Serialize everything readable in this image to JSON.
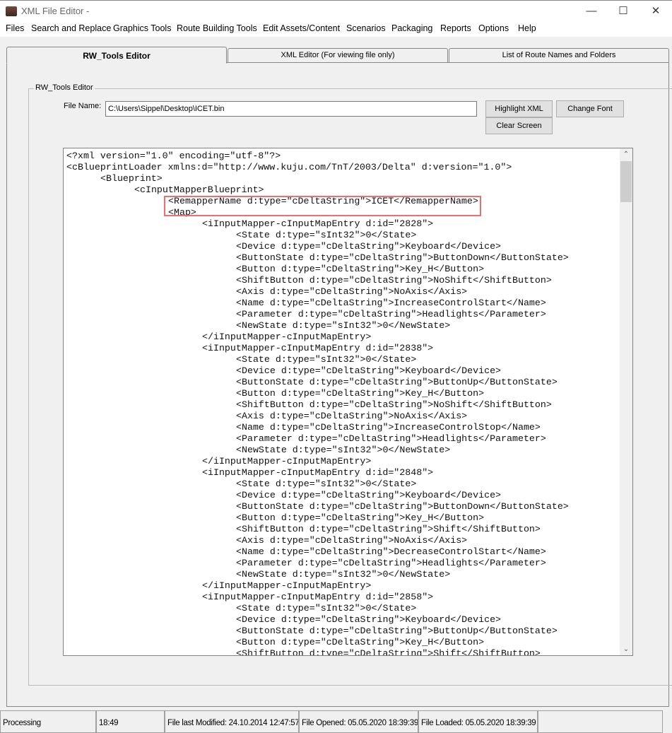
{
  "window": {
    "title": "XML File Editor -",
    "minimize": "—",
    "maximize": "☐",
    "close": "✕"
  },
  "menu": [
    "Files",
    "Search and Replace",
    "Graphics Tools",
    "Route Building Tools",
    "Edit Assets/Content",
    "Scenarios",
    "Packaging",
    "Reports",
    "Options",
    "Help"
  ],
  "tabs": [
    "RW_Tools Editor",
    "XML Editor (For viewing file only)",
    "List of Route Names and Folders"
  ],
  "group_label": "RW_Tools Editor",
  "file_name_label": "File Name:",
  "file_name_value": "C:\\Users\\Sippel\\Desktop\\ICET.bin",
  "buttons": {
    "highlight": "Highlight XML",
    "change_font": "Change Font",
    "clear": "Clear Screen"
  },
  "highlight_color": "#ef6f6f",
  "code_lines": [
    [
      0,
      "<?xml version=\"1.0\" encoding=\"utf-8\"?>"
    ],
    [
      0,
      "<cBlueprintLoader xmlns:d=\"http://www.kuju.com/TnT/2003/Delta\" d:version=\"1.0\">"
    ],
    [
      1,
      "<Blueprint>"
    ],
    [
      2,
      "<cInputMapperBlueprint>"
    ],
    [
      3,
      "<RemapperName d:type=\"cDeltaString\">ICET</RemapperName>"
    ],
    [
      3,
      "<Map>"
    ],
    [
      4,
      "<iInputMapper-cInputMapEntry d:id=\"2828\">"
    ],
    [
      5,
      "<State d:type=\"sInt32\">0</State>"
    ],
    [
      5,
      "<Device d:type=\"cDeltaString\">Keyboard</Device>"
    ],
    [
      5,
      "<ButtonState d:type=\"cDeltaString\">ButtonDown</ButtonState>"
    ],
    [
      5,
      "<Button d:type=\"cDeltaString\">Key_H</Button>"
    ],
    [
      5,
      "<ShiftButton d:type=\"cDeltaString\">NoShift</ShiftButton>"
    ],
    [
      5,
      "<Axis d:type=\"cDeltaString\">NoAxis</Axis>"
    ],
    [
      5,
      "<Name d:type=\"cDeltaString\">IncreaseControlStart</Name>"
    ],
    [
      5,
      "<Parameter d:type=\"cDeltaString\">Headlights</Parameter>"
    ],
    [
      5,
      "<NewState d:type=\"sInt32\">0</NewState>"
    ],
    [
      4,
      "</iInputMapper-cInputMapEntry>"
    ],
    [
      4,
      "<iInputMapper-cInputMapEntry d:id=\"2838\">"
    ],
    [
      5,
      "<State d:type=\"sInt32\">0</State>"
    ],
    [
      5,
      "<Device d:type=\"cDeltaString\">Keyboard</Device>"
    ],
    [
      5,
      "<ButtonState d:type=\"cDeltaString\">ButtonUp</ButtonState>"
    ],
    [
      5,
      "<Button d:type=\"cDeltaString\">Key_H</Button>"
    ],
    [
      5,
      "<ShiftButton d:type=\"cDeltaString\">NoShift</ShiftButton>"
    ],
    [
      5,
      "<Axis d:type=\"cDeltaString\">NoAxis</Axis>"
    ],
    [
      5,
      "<Name d:type=\"cDeltaString\">IncreaseControlStop</Name>"
    ],
    [
      5,
      "<Parameter d:type=\"cDeltaString\">Headlights</Parameter>"
    ],
    [
      5,
      "<NewState d:type=\"sInt32\">0</NewState>"
    ],
    [
      4,
      "</iInputMapper-cInputMapEntry>"
    ],
    [
      4,
      "<iInputMapper-cInputMapEntry d:id=\"2848\">"
    ],
    [
      5,
      "<State d:type=\"sInt32\">0</State>"
    ],
    [
      5,
      "<Device d:type=\"cDeltaString\">Keyboard</Device>"
    ],
    [
      5,
      "<ButtonState d:type=\"cDeltaString\">ButtonDown</ButtonState>"
    ],
    [
      5,
      "<Button d:type=\"cDeltaString\">Key_H</Button>"
    ],
    [
      5,
      "<ShiftButton d:type=\"cDeltaString\">Shift</ShiftButton>"
    ],
    [
      5,
      "<Axis d:type=\"cDeltaString\">NoAxis</Axis>"
    ],
    [
      5,
      "<Name d:type=\"cDeltaString\">DecreaseControlStart</Name>"
    ],
    [
      5,
      "<Parameter d:type=\"cDeltaString\">Headlights</Parameter>"
    ],
    [
      5,
      "<NewState d:type=\"sInt32\">0</NewState>"
    ],
    [
      4,
      "</iInputMapper-cInputMapEntry>"
    ],
    [
      4,
      "<iInputMapper-cInputMapEntry d:id=\"2858\">"
    ],
    [
      5,
      "<State d:type=\"sInt32\">0</State>"
    ],
    [
      5,
      "<Device d:type=\"cDeltaString\">Keyboard</Device>"
    ],
    [
      5,
      "<ButtonState d:type=\"cDeltaString\">ButtonUp</ButtonState>"
    ],
    [
      5,
      "<Button d:type=\"cDeltaString\">Key_H</Button>"
    ],
    [
      5,
      "<ShiftButton d:type=\"cDeltaString\">Shift</ShiftButton>"
    ]
  ],
  "status": [
    "Processing",
    "18:49",
    "File last Modified: 24.10.2014 12:47:57",
    "File Opened: 05.05.2020 18:39:39",
    "File Loaded: 05.05.2020 18:39:39",
    ""
  ]
}
